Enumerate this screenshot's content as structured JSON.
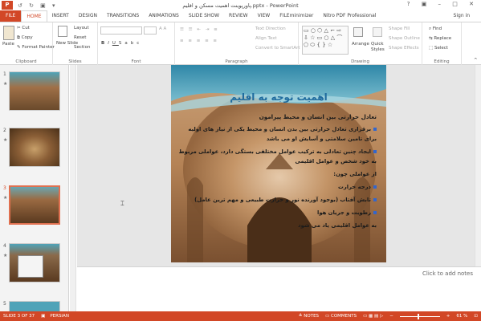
{
  "window": {
    "title": "پاورپوینت اهمیت مسکن و اقلیم.pptx - PowerPoint",
    "app_logo": "P"
  },
  "tabs": [
    "FILE",
    "HOME",
    "INSERT",
    "DESIGN",
    "TRANSITIONS",
    "ANIMATIONS",
    "SLIDE SHOW",
    "REVIEW",
    "VIEW",
    "FILEminimizer",
    "Nitro PDF Professional"
  ],
  "signin": "Sign in",
  "ribbon": {
    "clipboard": {
      "paste": "Paste",
      "cut": "Cut",
      "copy": "Copy",
      "format_painter": "Format Painter",
      "label": "Clipboard"
    },
    "slides": {
      "new_slide": "New Slide",
      "layout": "Layout",
      "reset": "Reset",
      "section": "Section",
      "label": "Slides"
    },
    "font": {
      "label": "Font",
      "bold": "B",
      "italic": "I",
      "underline": "U",
      "strike": "S",
      "shadow": "abc"
    },
    "paragraph": {
      "text_direction": "Text Direction",
      "align_text": "Align Text",
      "convert": "Convert to SmartArt",
      "label": "Paragraph"
    },
    "drawing": {
      "arrange": "Arrange",
      "quick_styles": "Quick Styles",
      "shape_fill": "Shape Fill",
      "shape_outline": "Shape Outline",
      "shape_effects": "Shape Effects",
      "label": "Drawing"
    },
    "editing": {
      "find": "Find",
      "replace": "Replace",
      "select": "Select",
      "label": "Editing"
    }
  },
  "thumbnails": [
    {
      "num": "1",
      "star": "★"
    },
    {
      "num": "2",
      "star": "★"
    },
    {
      "num": "3",
      "star": "★"
    },
    {
      "num": "4",
      "star": "★"
    },
    {
      "num": "5",
      "star": ""
    }
  ],
  "slide": {
    "title": "اهمیت توجه به اقلیم",
    "subtitle": "تعادل حرارتی بین انسان و محیط پیرامون",
    "lines": [
      "برقراری تعادل حرارتی بین بدن انسان و محیط یکی از نیاز های اولیه",
      "برای تامین سلامتی و آسایش او می باشد",
      "ایجاد چنین تعادلی به ترکیب عوامل مختلفی بستگی دارد، عواملی مربوط",
      "به خود شخص و عوامل اقلیمی",
      "از عواملی چون:",
      "درجه حرارت",
      "تابش آفتاب (بوجود آورنده نور و حرارت طبیعی و مهم ترین عامل)",
      "رطوبت و جریان هوا",
      "به عوامل اقلیمی یاد می شود"
    ]
  },
  "notes_placeholder": "Click to add notes",
  "status": {
    "slide_info": "SLIDE 3 OF 37",
    "language": "PERSIAN",
    "notes": "NOTES",
    "comments": "COMMENTS",
    "zoom": "61 %"
  },
  "colors": {
    "accent": "#d24726",
    "slide_bg": "#8a5a35",
    "title_blue": "#1f6b9e"
  }
}
